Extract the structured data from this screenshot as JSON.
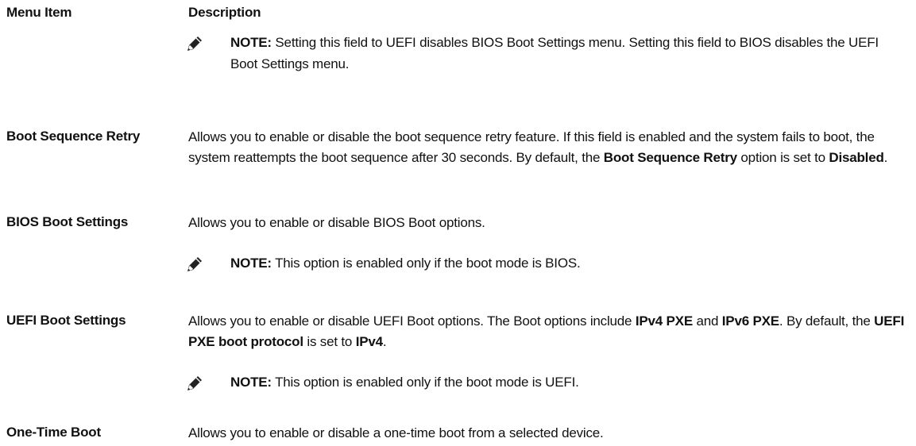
{
  "header": {
    "menu_item": "Menu Item",
    "description": "Description"
  },
  "note_label": "NOTE:",
  "top_note": {
    "text": "Setting this field to UEFI disables BIOS Boot Settings menu. Setting this field to BIOS disables the UEFI Boot Settings menu."
  },
  "rows": [
    {
      "label": "Boot Sequence Retry",
      "desc_parts": {
        "p1": "Allows you to enable or disable the boot sequence retry feature. If this field is enabled and the system fails to boot, the system reattempts the boot sequence after 30 seconds. By default, the ",
        "b1": "Boot Sequence Retry",
        "p2": " option is set to ",
        "b2": "Disabled",
        "p3": "."
      }
    },
    {
      "label": "BIOS Boot Settings",
      "desc": "Allows you to enable or disable BIOS Boot options.",
      "note": "This option is enabled only if the boot mode is BIOS."
    },
    {
      "label": "UEFI Boot Settings",
      "desc_parts": {
        "p1": "Allows you to enable or disable UEFI Boot options. The Boot options include ",
        "b1": "IPv4 PXE",
        "p2": " and ",
        "b2": "IPv6 PXE",
        "p3": ". By default, the ",
        "b3": "UEFI PXE boot protocol",
        "p4": " is set to ",
        "b4": "IPv4",
        "p5": "."
      },
      "note": "This option is enabled only if the boot mode is UEFI."
    },
    {
      "label": "One-Time Boot",
      "desc": "Allows you to enable or disable a one-time boot from a selected device."
    }
  ],
  "icons": {
    "note": "pencil-note-icon"
  }
}
